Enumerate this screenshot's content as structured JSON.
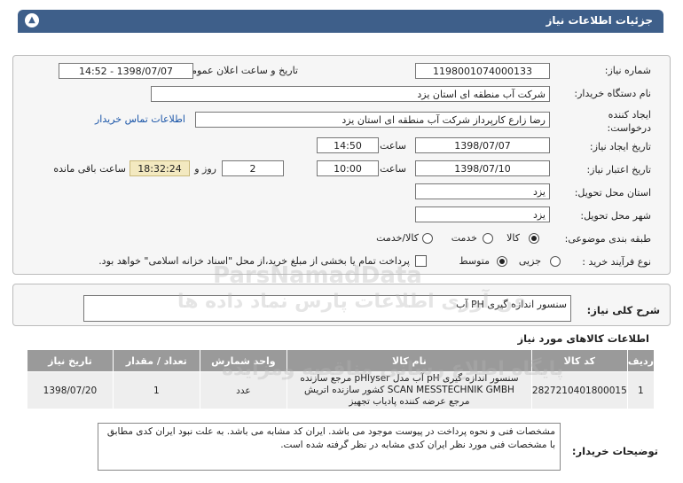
{
  "header": {
    "title": "جزئیات اطلاعات نیاز",
    "collapse_icon": "chevron-up-icon"
  },
  "form": {
    "need_number_label": "شماره نیاز:",
    "need_number": "1198001074000133",
    "announce_label": "تاریخ و ساعت اعلان عمومی:",
    "announce_value": "1398/07/07 - 14:52",
    "buyer_label": "نام دستگاه خریدار:",
    "buyer_value": "شرکت آب منطقه ای استان یزد",
    "creator_label": "ایجاد کننده درخواست:",
    "creator_value": "رضا زارع کارپرداز شرکت آب منطقه ای استان یزد",
    "contact_link": "اطلاعات تماس خریدار",
    "create_date_label": "تاریخ ایجاد نیاز:",
    "create_date": "1398/07/07",
    "time_label": "ساعت",
    "create_time": "14:50",
    "validity_label": "تاریخ اعتبار نیاز:",
    "validity_date": "1398/07/10",
    "validity_time": "10:00",
    "days_value": "2",
    "days_label": "روز و",
    "remaining_time": "18:32:24",
    "remaining_label": "ساعت باقی مانده",
    "province_label": "استان محل تحویل:",
    "province_value": "یزد",
    "city_label": "شهر محل تحویل:",
    "city_value": "یزد",
    "category_label": "طبقه بندی موضوعی:",
    "category_options": [
      "کالا",
      "خدمت",
      "کالا/خدمت"
    ],
    "category_selected": 0,
    "process_label": "نوع فرآیند خرید :",
    "process_options": [
      "جزیی",
      "متوسط"
    ],
    "process_selected": 1,
    "payment_note": "پرداخت تمام یا بخشی از مبلغ خرید،از محل \"اسناد خزانه اسلامی\" خواهد بود."
  },
  "summary": {
    "label": "شرح کلی نیاز:",
    "value": "سنسور اندازه گیری PH آب"
  },
  "goods": {
    "title": "اطلاعات کالاهای مورد نیاز",
    "columns": [
      "ردیف",
      "کد کالا",
      "نام کالا",
      "واحد شمارش",
      "تعداد / مقدار",
      "تاریخ نیاز"
    ],
    "rows": [
      {
        "row": "1",
        "code": "2827210401800015",
        "name": "سنسور اندازه گیری pH آب مدل pHlyser مرجع سازنده SCAN MESSTECHNIK GMBH کشور سازنده اتریش مرجع عرضه کننده پادیاب تجهیز",
        "unit": "عدد",
        "qty": "1",
        "date": "1398/07/20"
      }
    ]
  },
  "notes": {
    "label": "توضیحات خریدار:",
    "text": "مشخصات فنی و نحوه پرداخت در پیوست موجود می باشد. ایران کد مشابه می باشد. به علت نبود ایران کدی مطابق با مشخصات فنی مورد نظر ایران کدی مشابه در نظر گرفته شده است."
  },
  "watermark": {
    "line1": "ParsNamadData",
    "line2": "پایگاه اطلاع رسانی مناقصه ومزایده",
    "line3": "فن آوری اطلاعات پارس نماد داده ها"
  }
}
